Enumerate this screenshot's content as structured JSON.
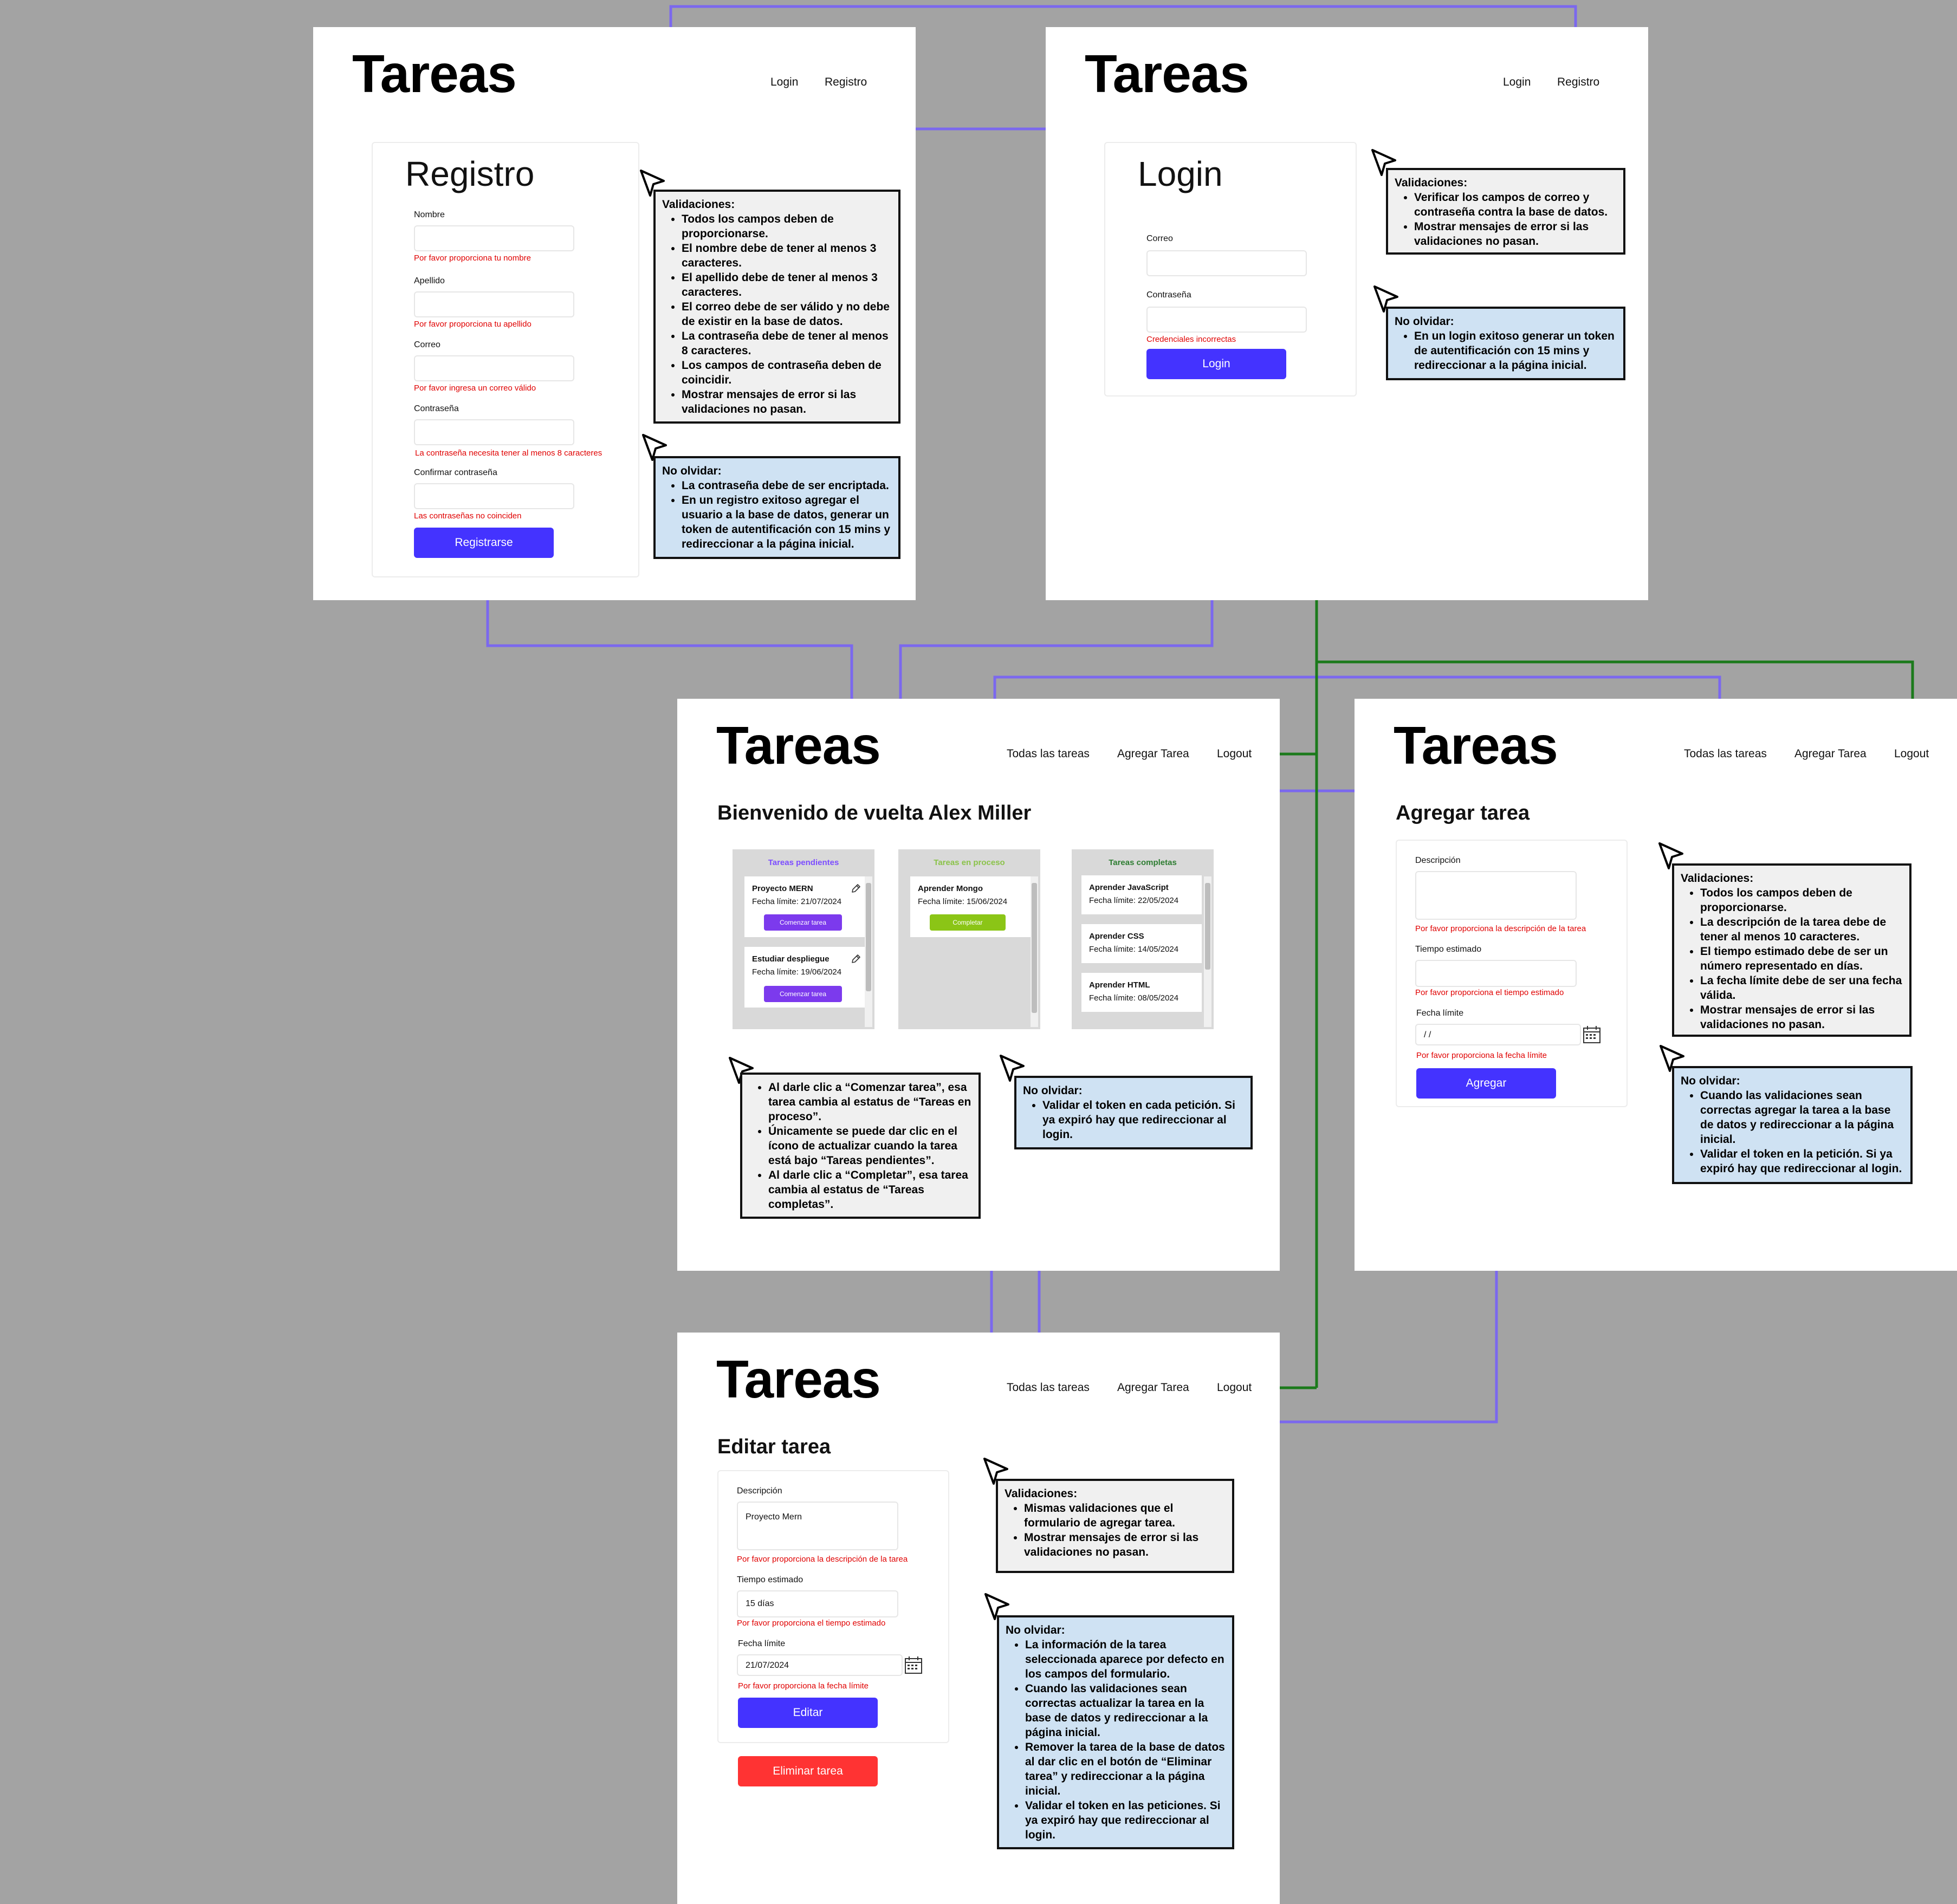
{
  "brand": "Tareas",
  "nav": {
    "login": "Login",
    "registro": "Registro",
    "todas_tareas": "Todas las tareas",
    "agregar_tarea": "Agregar Tarea",
    "logout": "Logout"
  },
  "registro": {
    "title": "Registro",
    "fields": [
      {
        "label": "Nombre",
        "value": "",
        "error": "Por favor proporciona tu nombre"
      },
      {
        "label": "Apellido",
        "value": "",
        "error": "Por favor proporciona tu apellido"
      },
      {
        "label": "Correo",
        "value": "",
        "error": "Por favor ingresa un correo válido"
      },
      {
        "label": "Contraseña",
        "value": "",
        "error": "La contraseña necesita tener al menos 8 caracteres"
      },
      {
        "label": "Confirmar contraseña",
        "value": "",
        "error": "Las contraseñas no coinciden"
      }
    ],
    "button": "Registrarse",
    "validaciones_title": "Validaciones:",
    "validaciones": [
      "Todos los campos deben de proporcionarse.",
      "El nombre debe de tener al menos 3 caracteres.",
      "El apellido debe de tener al menos 3 caracteres.",
      "El correo debe de ser válido y no debe de existir en la base de datos.",
      "La contraseña debe de tener al menos 8 caracteres.",
      "Los campos de contraseña deben de coincidir.",
      "Mostrar mensajes de error si las validaciones no pasan."
    ],
    "no_olvidar_title": "No olvidar:",
    "no_olvidar": [
      "La contraseña debe de ser encriptada.",
      "En un registro exitoso agregar el usuario a la base de datos, generar un token de autentificación con 15 mins y redireccionar a la página inicial."
    ]
  },
  "login": {
    "title": "Login",
    "fields": [
      {
        "label": "Correo",
        "value": "",
        "error": ""
      },
      {
        "label": "Contraseña",
        "value": "",
        "error": "Credenciales incorrectas"
      }
    ],
    "button": "Login",
    "validaciones_title": "Validaciones:",
    "validaciones": [
      "Verificar los campos de correo y contraseña contra la base de datos.",
      "Mostrar mensajes de error si las validaciones no pasan."
    ],
    "no_olvidar_title": "No olvidar:",
    "no_olvidar": [
      "En un login exitoso generar un token de autentificación con 15 mins y redireccionar a la página inicial."
    ]
  },
  "dashboard": {
    "welcome": "Bienvenido de vuelta Alex Miller",
    "columns": [
      {
        "title": "Tareas pendientes",
        "color": "#7c4dff",
        "tasks": [
          {
            "name": "Proyecto MERN",
            "date": "Fecha límite: 21/07/2024",
            "button": "Comenzar tarea"
          },
          {
            "name": "Estudiar despliegue",
            "date": "Fecha límite: 19/06/2024",
            "button": "Comenzar tarea"
          }
        ]
      },
      {
        "title": "Tareas en proceso",
        "color": "#8bc34a",
        "tasks": [
          {
            "name": "Aprender Mongo",
            "date": "Fecha límite: 15/06/2024",
            "button": "Completar"
          }
        ]
      },
      {
        "title": "Tareas completas",
        "color": "#2e7d32",
        "tasks": [
          {
            "name": "Aprender JavaScript",
            "date": "Fecha límite: 22/05/2024"
          },
          {
            "name": "Aprender CSS",
            "date": "Fecha límite: 14/05/2024"
          },
          {
            "name": "Aprender HTML",
            "date": "Fecha límite: 08/05/2024"
          }
        ]
      }
    ],
    "notes": [
      "Al darle clic a “Comenzar tarea”, esa tarea cambia al estatus de “Tareas en proceso”.",
      "Únicamente se puede dar clic en el ícono de actualizar cuando la tarea está bajo “Tareas pendientes”.",
      "Al darle clic a “Completar”, esa tarea cambia al estatus de “Tareas completas”."
    ],
    "no_olvidar_title": "No olvidar:",
    "no_olvidar": [
      "Validar el token en cada petición. Si ya expiró hay que redireccionar al login."
    ]
  },
  "agregar": {
    "title": "Agregar tarea",
    "fields": [
      {
        "label": "Descripción",
        "value": "",
        "error": "Por favor proporciona la descripción de la tarea"
      },
      {
        "label": "Tiempo estimado",
        "value": "",
        "error": "Por favor proporciona el tiempo estimado"
      },
      {
        "label": "Fecha límite",
        "value": "  /   /",
        "error": "Por favor proporciona la fecha límite"
      }
    ],
    "button": "Agregar",
    "validaciones_title": "Validaciones:",
    "validaciones": [
      "Todos los campos deben de proporcionarse.",
      "La descripción de la tarea debe de tener al menos 10 caracteres.",
      "El tiempo estimado debe de ser un número representado en días.",
      "La fecha límite debe de ser una fecha válida.",
      "Mostrar mensajes de error si las validaciones no pasan."
    ],
    "no_olvidar_title": "No olvidar:",
    "no_olvidar": [
      "Cuando las validaciones sean correctas agregar la tarea a la base de datos y redireccionar a la página inicial.",
      "Validar el token en la petición. Si ya expiró hay que redireccionar al login."
    ]
  },
  "editar": {
    "title": "Editar tarea",
    "fields": [
      {
        "label": "Descripción",
        "value": "Proyecto Mern",
        "error": "Por favor proporciona la descripción de la tarea"
      },
      {
        "label": "Tiempo estimado",
        "value": "15 días",
        "error": "Por favor proporciona el tiempo estimado"
      },
      {
        "label": "Fecha límite",
        "value": "21/07/2024",
        "error": "Por favor proporciona la fecha límite"
      }
    ],
    "button": "Editar",
    "delete_button": "Eliminar tarea",
    "validaciones_title": "Validaciones:",
    "validaciones": [
      "Mismas validaciones que el formulario de agregar tarea.",
      "Mostrar mensajes de error si las validaciones no pasan."
    ],
    "no_olvidar_title": "No olvidar:",
    "no_olvidar": [
      "La información de la tarea seleccionada aparece por defecto en los campos del formulario.",
      "Cuando las validaciones sean correctas actualizar la tarea en la base de datos y redireccionar a la página inicial.",
      "Remover la tarea de la base de datos al dar clic en el botón de “Eliminar tarea” y redireccionar a la página inicial.",
      "Validar el token en las peticiones. Si ya expiró hay que redireccionar al login."
    ]
  },
  "colors": {
    "primary_button": "#4433ff",
    "danger_button": "#ff3333",
    "error_text": "#e00000",
    "flow_arrow": "#7b68ee",
    "logout_arrow": "#1b7a1b",
    "note_grey": "#f0f0f0",
    "note_blue": "#cfe2f3"
  }
}
